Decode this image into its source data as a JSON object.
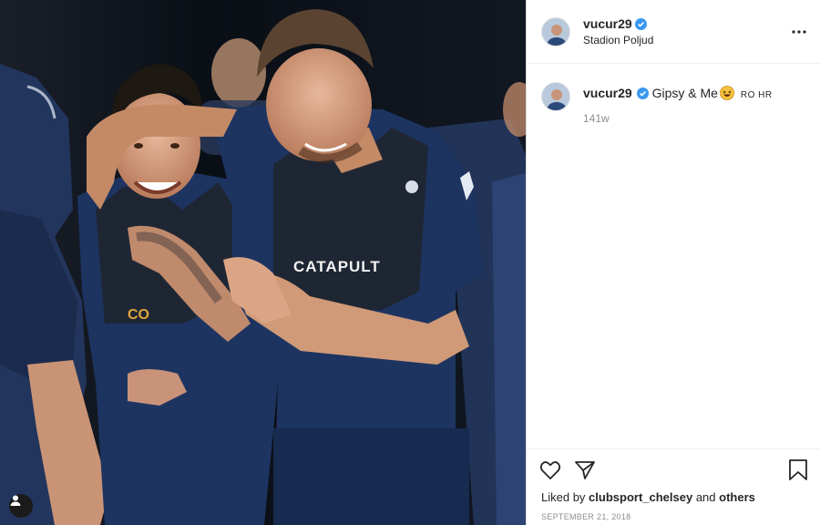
{
  "post": {
    "username": "vucur29",
    "verified": true,
    "location": "Stadion Poljud",
    "caption_text": "Gipsy & Me",
    "caption_emoji": "grinning-squinting-face",
    "caption_suffix": "RO HR",
    "age": "141w",
    "liked_by_prefix": "Liked by",
    "liked_by_user": "clubsport_chelsey",
    "liked_by_and": "and",
    "liked_by_others": "others",
    "date": "SEPTEMBER 21, 2018"
  },
  "media": {
    "shirt_text": "CATAPULT",
    "partial_text": "CO"
  },
  "colors": {
    "verified": "#3897f0",
    "jersey": "#1d3461",
    "vest": "#1f2633"
  }
}
